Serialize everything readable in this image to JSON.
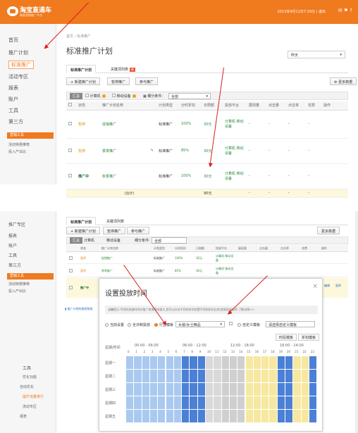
{
  "header": {
    "logo_title": "淘宝直通车",
    "logo_subtitle": "精准营销推广平台",
    "user_info": "2013年4月11日7:29分 | 退出",
    "icons": [
      "mail-icon",
      "help-icon"
    ],
    "icon_glyphs": "✉ ⚑ ?"
  },
  "sidebar1": {
    "items": [
      "首页",
      "推广计划",
      "标准推广",
      "活动专区",
      "报表",
      "账户",
      "工具",
      "第三方"
    ],
    "orange_label": "营销工具",
    "sub_items": [
      "活动特惠推荐",
      "投入产出比"
    ]
  },
  "main1": {
    "breadcrumb": "首页  ›  标准推广",
    "title": "标准推广计划",
    "day_select": "昨天",
    "tabs": [
      {
        "label": "标准推广计划"
      },
      {
        "label": "关键词列表",
        "badge": "新"
      }
    ],
    "buttons": {
      "new_plan": "+ 新建推广计划",
      "pause": "暂停推广",
      "resume": "参与推广",
      "more_data": "更多数据"
    },
    "filters": {
      "tag": "汇总",
      "computer": "计算机",
      "mobile": "移动设备",
      "cond": "细分条件:",
      "all": "全部"
    },
    "table": {
      "headers": [
        "状态",
        "推广计划名称",
        "计划类型",
        "分时折扣",
        "日限额",
        "投放平台",
        "展现量",
        "点击量",
        "点击率",
        "花费",
        "操作"
      ],
      "rows": [
        {
          "status": "暂停",
          "status_color": "orange",
          "name": "促销推广",
          "type": "标准推广",
          "discount": "100%",
          "limit": "30元",
          "platform": "计算机 移动设备"
        },
        {
          "status": "暂停",
          "status_color": "orange",
          "name": "季季推广",
          "type": "标准推广",
          "discount": "85%",
          "limit": "30元",
          "platform": "计算机 移动设备"
        },
        {
          "status": "推广中",
          "status_color": "green",
          "name": "秋季推广",
          "type": "标准推广",
          "discount": "100%",
          "limit": "30元",
          "platform": "计算机 移动设备"
        }
      ],
      "total_label": "(合计)",
      "total_limit": "90元",
      "dash": "-"
    }
  },
  "sidebar2": {
    "items": [
      "推广专区",
      "报表",
      "账户",
      "工具",
      "第三方"
    ],
    "orange_label": "营销工具",
    "sub_items": [
      "活动特惠推荐",
      "投入产出比"
    ],
    "bottom_items": [
      "工具",
      "优化功能",
      "自动优化",
      "提升流量排行",
      "流动专区",
      "报表"
    ]
  },
  "main2": {
    "tabs": [
      "标准推广计划",
      "关键词列表"
    ],
    "buttons": [
      "+ 新建推广计划",
      "暂停推广",
      "参与推广",
      "更多数据"
    ],
    "link": "推广计划的使用帮助",
    "rows": [
      {
        "status": "暂停",
        "name": "促销推广",
        "type": "标准推广",
        "discount": "100%",
        "limit": "30元",
        "platform": "计算机 移动设备"
      },
      {
        "status": "暂停",
        "name": "季季推广",
        "type": "标准推广",
        "discount": "85%",
        "limit": "30元",
        "platform": "计算机 移动设备"
      },
      {
        "status": "推广中",
        "name": "秋季推广",
        "type": "标准推广",
        "discount": "100%",
        "limit": "30元",
        "platform": "计算机 移动设备"
      }
    ],
    "actions": [
      "编辑",
      "暂停"
    ]
  },
  "modal": {
    "title": "设置投放时间",
    "close": "×",
    "note": "温馨提示:不同的投放时间对推广效果影响很大,您可以针对不同的时间设置不同的折扣比例,提高投放效率,了解详情>>",
    "options": [
      "当前设置",
      "全日制投放",
      "行业模板",
      "自定义模板"
    ],
    "industry_value": "女装/女士精品",
    "template_select": "请选择自定义模板",
    "btn_times": "时段模板",
    "btn_discount": "折扣模板",
    "time_headers": [
      "00:00 - 06:00",
      "06:00 - 12:00",
      "12:00 - 18:00",
      "18:00 - 24:00"
    ],
    "hour_header": "星期/时间",
    "days": [
      "星期一",
      "星期二",
      "星期三",
      "星期四",
      "星期五"
    ],
    "hours": [
      "0",
      "1",
      "2",
      "3",
      "4",
      "5",
      "6",
      "7",
      "8",
      "9",
      "10",
      "11",
      "12",
      "13",
      "14",
      "15",
      "16",
      "17",
      "18",
      "19",
      "20",
      "21",
      "22",
      "23"
    ],
    "hour_levels": [
      2,
      2,
      2,
      2,
      2,
      2,
      2,
      3,
      3,
      3,
      0,
      0,
      1,
      1,
      1,
      4,
      4,
      4,
      4,
      3,
      3,
      4,
      4,
      3
    ],
    "level_colors": [
      "#d9d9d9",
      "#cfcfcf",
      "#a9c9f0",
      "#4a80d6",
      "#f6e8a0"
    ]
  }
}
